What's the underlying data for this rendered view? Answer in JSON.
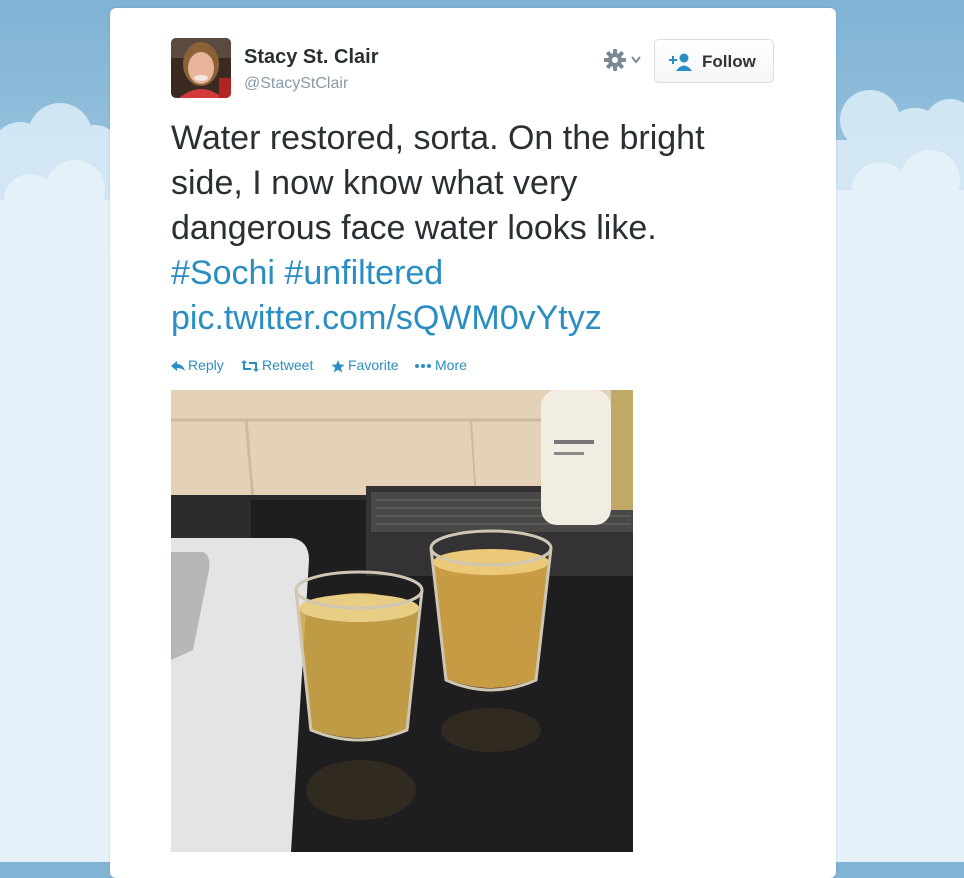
{
  "tweet": {
    "author": {
      "name": "Stacy St. Clair",
      "handle": "@StacyStClair"
    },
    "header": {
      "follow_label": "Follow",
      "gear_icon": "gear-icon",
      "follow_icon": "add-user-icon"
    },
    "text": {
      "line1": "Water restored, sorta. On the bright",
      "line2": "side, I now know what very",
      "line3": "dangerous face water looks like.",
      "hashtag1": "#Sochi",
      "hashtag2": "#unfiltered",
      "pic_link": "pic.twitter.com/sQWM0vYtyz"
    },
    "actions": {
      "reply": "Reply",
      "retweet": "Retweet",
      "favorite": "Favorite",
      "more": "More"
    },
    "colors": {
      "link": "#2a8ec2",
      "text": "#292f33",
      "handle": "#8899a6"
    }
  }
}
